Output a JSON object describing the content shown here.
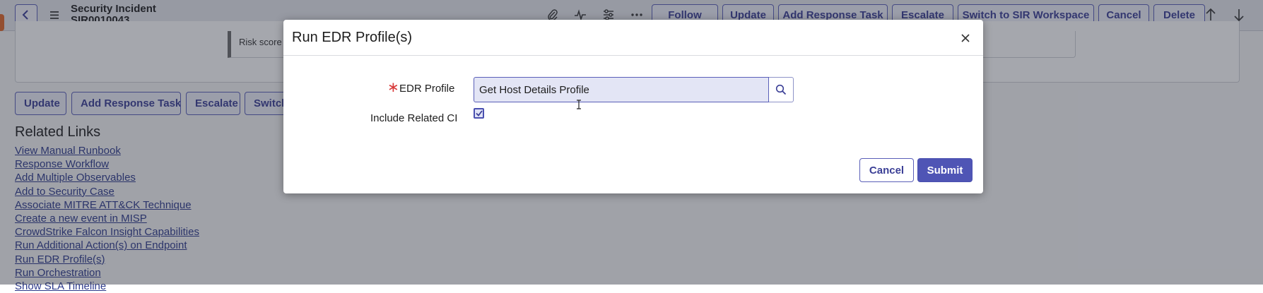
{
  "header": {
    "title_line1": "Security Incident",
    "title_line2": "SIR0010043",
    "icons": [
      "back-icon",
      "menu-icon",
      "paperclip-icon",
      "activity-icon",
      "sliders-icon",
      "more-icon",
      "arrow-up-icon",
      "arrow-down-icon"
    ],
    "buttons": {
      "follow": "Follow",
      "update": "Update",
      "add_response_task": "Add Response Task",
      "escalate": "Escalate",
      "switch_sir": "Switch to SIR Workspace",
      "cancel": "Cancel",
      "delete": "Delete"
    }
  },
  "background": {
    "risk_text": "Risk score",
    "action_buttons": {
      "update": "Update",
      "add_response_task": "Add Response Task",
      "escalate": "Escalate",
      "switch": "Switch"
    },
    "related_links_title": "Related Links",
    "related_links": [
      "View Manual Runbook",
      "Response Workflow",
      "Add Multiple Observables",
      "Add to Security Case",
      "Associate MITRE ATT&CK Technique",
      "Create a new event in MISP",
      "CrowdStrike Falcon Insight Capabilities",
      "Run Additional Action(s) on Endpoint",
      "Run EDR Profile(s)",
      "Run Orchestration",
      "Show SLA Timeline"
    ]
  },
  "modal": {
    "title": "Run EDR Profile(s)",
    "required_mark": "∗",
    "edr_profile_label": "EDR Profile",
    "edr_profile_value": "Get Host Details Profile",
    "include_related_ci_label": "Include Related CI",
    "include_related_ci_checked": true,
    "cancel_label": "Cancel",
    "submit_label": "Submit"
  },
  "colors": {
    "accent": "#4f55b5",
    "required": "#d83a3a",
    "link": "#2d3a8c"
  }
}
